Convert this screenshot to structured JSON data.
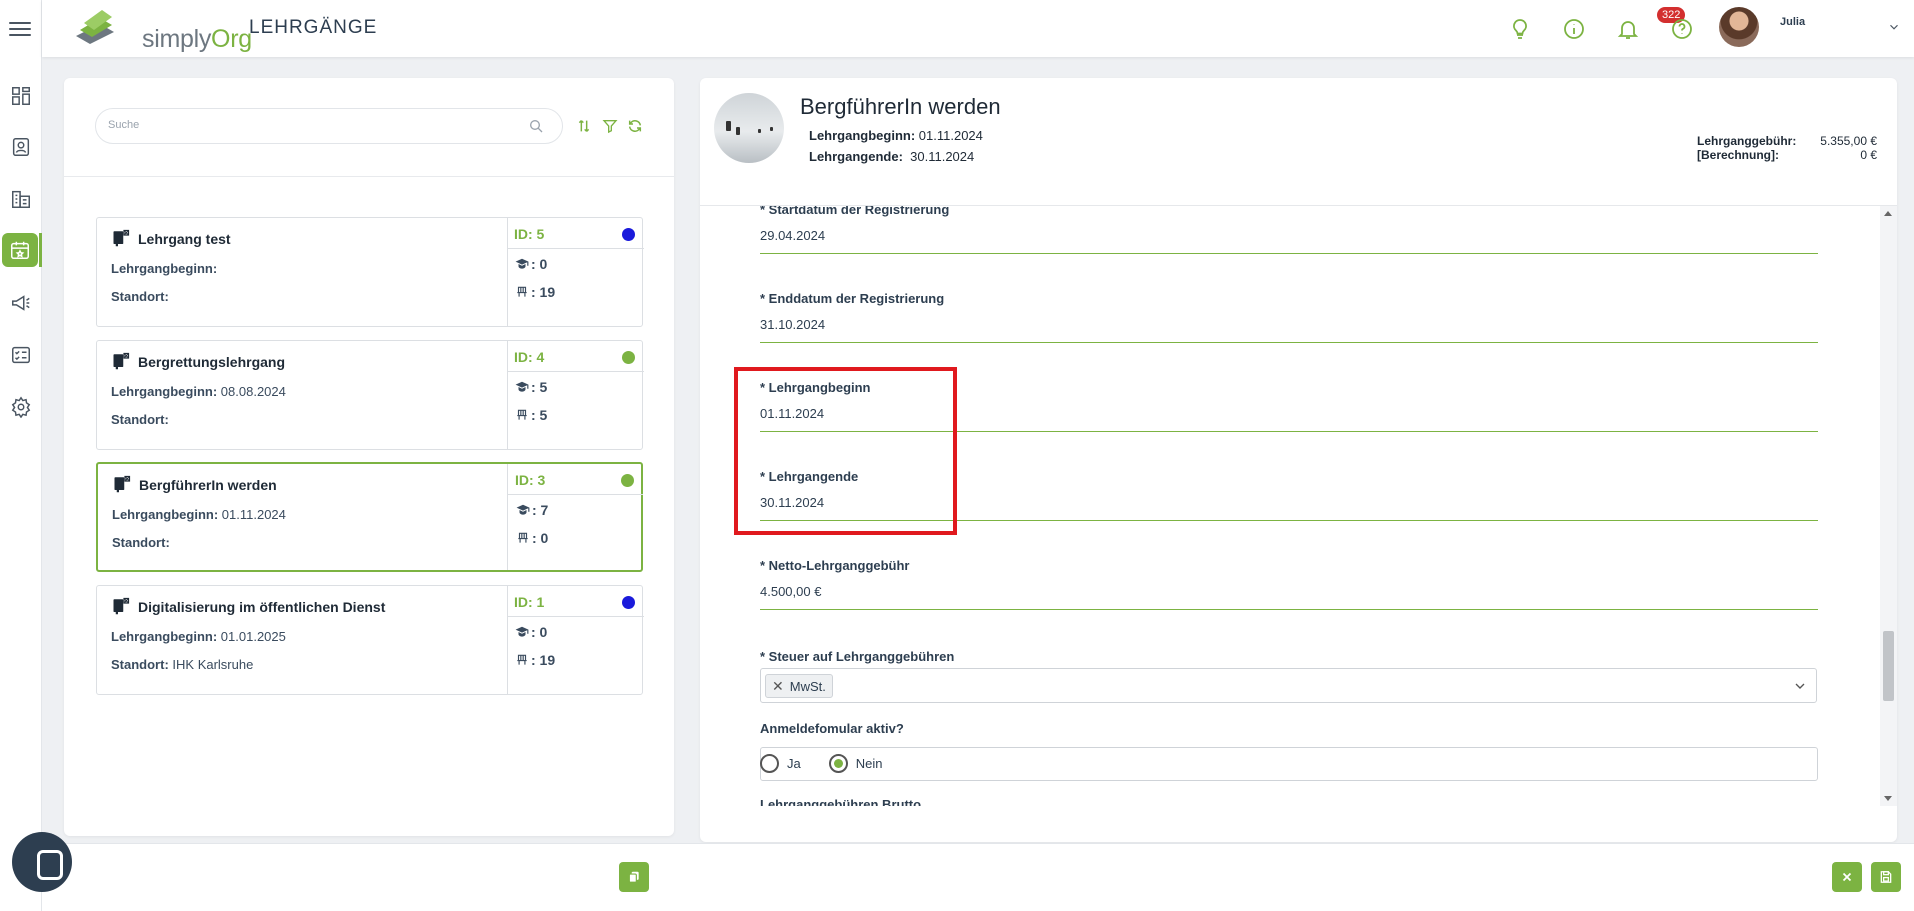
{
  "app": {
    "logo_main": "simply",
    "logo_accent": "Org",
    "page_title": "LEHRGÄNGE"
  },
  "header": {
    "notification_count": "322",
    "user_name": "Julia"
  },
  "search": {
    "placeholder": "Suche"
  },
  "courses": [
    {
      "title": "Lehrgang test",
      "begin_label": "Lehrgangbeginn:",
      "begin_value": "",
      "location_label": "Standort:",
      "location_value": "",
      "id": "ID: 5",
      "dot_color": "#1a1adb",
      "participants": ": 0",
      "seats": ": 19"
    },
    {
      "title": "Bergrettungslehrgang",
      "begin_label": "Lehrgangbeginn:",
      "begin_value": "08.08.2024",
      "location_label": "Standort:",
      "location_value": "",
      "id": "ID: 4",
      "dot_color": "#7cb342",
      "participants": ": 5",
      "seats": ": 5"
    },
    {
      "title": "BergführerIn werden",
      "begin_label": "Lehrgangbeginn:",
      "begin_value": "01.11.2024",
      "location_label": "Standort:",
      "location_value": "",
      "id": "ID: 3",
      "dot_color": "#7cb342",
      "participants": ": 7",
      "seats": ": 0"
    },
    {
      "title": "Digitalisierung im öffentlichen Dienst",
      "begin_label": "Lehrgangbeginn:",
      "begin_value": "01.01.2025",
      "location_label": "Standort:",
      "location_value": "IHK Karlsruhe",
      "id": "ID: 1",
      "dot_color": "#1a1adb",
      "participants": ": 0",
      "seats": ": 19"
    }
  ],
  "detail": {
    "title": "BergführerIn werden",
    "begin_label": "Lehrgangbeginn:",
    "begin_value": "01.11.2024",
    "end_label": "Lehrgangende:",
    "end_value": "30.11.2024",
    "fee_label": "Lehrganggebühr:",
    "fee_value": "5.355,00 €",
    "calc_label": "[Berechnung]:",
    "calc_value": "0 €"
  },
  "form": {
    "fields": [
      {
        "label": "* Startdatum der Registrierung",
        "value": "29.04.2024"
      },
      {
        "label": "* Enddatum der Registrierung",
        "value": "31.10.2024"
      },
      {
        "label": "* Lehrgangbeginn",
        "value": "01.11.2024"
      },
      {
        "label": "* Lehrgangende",
        "value": "30.11.2024"
      },
      {
        "label": "* Netto-Lehrganggebühr",
        "value": "4.500,00 €"
      }
    ],
    "tax_label": "* Steuer auf Lehrganggebühren",
    "tax_chip": "MwSt.",
    "tax_chip_remove": "✕",
    "signup_label": "Anmeldefomular aktiv?",
    "radio_yes": "Ja",
    "radio_no": "Nein",
    "next_label_partial": "Lehrganggebühren Brutto"
  },
  "colors": {
    "accent": "#7cb342",
    "highlight": "#e0191e",
    "badge": "#d32f2f"
  }
}
